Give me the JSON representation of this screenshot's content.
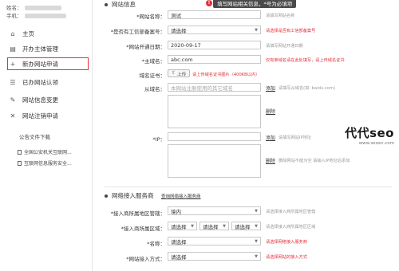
{
  "sidebar": {
    "name_label": "姓名：",
    "phone_label": "手机：",
    "items": [
      {
        "icon": "home-icon",
        "glyph": "⌂",
        "label": "主页"
      },
      {
        "icon": "document-icon",
        "glyph": "▤",
        "label": "开办主体管理"
      },
      {
        "icon": "plus-icon",
        "glyph": "+",
        "label": "新办网站申请"
      },
      {
        "icon": "list-check-icon",
        "glyph": "☰",
        "label": "已办网站认领"
      },
      {
        "icon": "edit-icon",
        "glyph": "✎",
        "label": "网站信息变更"
      },
      {
        "icon": "close-icon",
        "glyph": "✕",
        "label": "网站注销申请"
      }
    ],
    "downloads_title": "公告文件下载",
    "downloads": [
      "全国公安机关互联网...",
      "互联网信息服务安全..."
    ]
  },
  "tooltip": {
    "text": "填写网站相关信息，*号为必填项",
    "icon": "warning-icon"
  },
  "section1": {
    "title": "网站信息",
    "fields": {
      "site_name": {
        "label": "*网站名称：",
        "value": "测试",
        "hint": "请填写网站名称"
      },
      "icp": {
        "label": "*是否有工信部备案号：",
        "value": "请选择",
        "hint": "请选择是否有工信部备案号"
      },
      "open_date": {
        "label": "*网站开通日期：",
        "value": "2020-09-17",
        "hint": "请填写网站开通日期"
      },
      "domain": {
        "label": "*主域名：",
        "value": "abc.com",
        "hint": "仅有单域名请在此处填写，请上传域名证书"
      },
      "cert": {
        "label": "域名证书：",
        "button": "上传",
        "hint": "请上传域名证书图片（400KB以内）"
      },
      "sub_domain": {
        "label": "从域名：",
        "placeholder": "本网站注册使用的其它域名",
        "add": "添加",
        "remove": "删除",
        "hint": "请填写从域名(如: baidu.com)"
      },
      "ip": {
        "label": "*IP：",
        "add": "添加",
        "remove": "删除",
        "hint": "请填写网站IP地址",
        "hint2": "删除网站不能为空 请输入IP地址后添加"
      }
    }
  },
  "section2": {
    "title": "网络接入服务商",
    "link": "查询网络接入服务商",
    "fields": {
      "province": {
        "label": "*接入商所属地区管辖：",
        "value": "境内",
        "hint": "请选择接入商所属地区管辖"
      },
      "region": {
        "label": "*接入商所属区域：",
        "values": [
          "请选择",
          "请选择",
          "请选择"
        ],
        "hint": "请选择接入商所属地区区域"
      },
      "isp_name": {
        "label": "*名称：",
        "value": "请选择",
        "hint": "请选择网络接入服务商"
      },
      "access": {
        "label": "*网站接入方式：",
        "value": "请选择",
        "hint": "请选择网站的接入方式"
      }
    }
  },
  "watermark": {
    "title": "代代seo",
    "url": "www.seoxn.com"
  }
}
